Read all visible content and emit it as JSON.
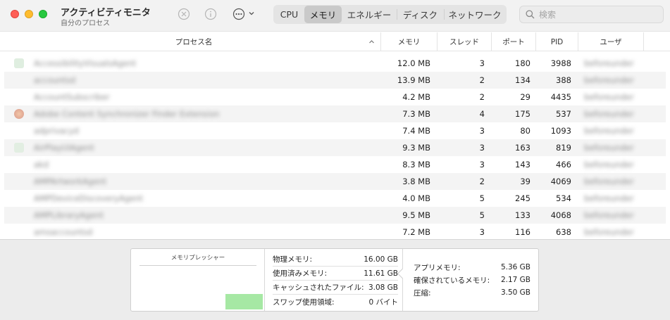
{
  "window": {
    "title": "アクティビティモニタ",
    "subtitle": "自分のプロセス"
  },
  "toolbar": {
    "stop_icon": "x-circle-icon",
    "info_icon": "info-icon",
    "more_icon": "ellipsis-circle-icon",
    "tabs": [
      {
        "label": "CPU",
        "active": false
      },
      {
        "label": "メモリ",
        "active": true
      },
      {
        "label": "エネルギー",
        "active": false
      },
      {
        "label": "ディスク",
        "active": false
      },
      {
        "label": "ネットワーク",
        "active": false
      }
    ],
    "search_placeholder": "検索"
  },
  "table": {
    "headers": {
      "name": "プロセス名",
      "memory": "メモリ",
      "threads": "スレッド",
      "ports": "ポート",
      "pid": "PID",
      "user": "ユーザ"
    },
    "rows": [
      {
        "name": "AccessibilityVisualsAgent",
        "memory": "12.0 MB",
        "threads": "3",
        "ports": "180",
        "pid": "3988",
        "user": "beforeunder",
        "icon_color": "#dfeee0"
      },
      {
        "name": "accountsd",
        "memory": "13.9 MB",
        "threads": "2",
        "ports": "134",
        "pid": "388",
        "user": "beforeunder",
        "icon_color": ""
      },
      {
        "name": "AccountSubscriber",
        "memory": "4.2 MB",
        "threads": "2",
        "ports": "29",
        "pid": "4435",
        "user": "beforeunder",
        "icon_color": ""
      },
      {
        "name": "Adobe Content Synchronizer Finder Extension",
        "memory": "7.3 MB",
        "threads": "4",
        "ports": "175",
        "pid": "537",
        "user": "beforeunder",
        "icon_color": "#e9b9a4"
      },
      {
        "name": "adprivacyd",
        "memory": "7.4 MB",
        "threads": "3",
        "ports": "80",
        "pid": "1093",
        "user": "beforeunder",
        "icon_color": ""
      },
      {
        "name": "AirPlayUIAgent",
        "memory": "9.3 MB",
        "threads": "3",
        "ports": "163",
        "pid": "819",
        "user": "beforeunder",
        "icon_color": "#e2eee2"
      },
      {
        "name": "akd",
        "memory": "8.3 MB",
        "threads": "3",
        "ports": "143",
        "pid": "466",
        "user": "beforeunder",
        "icon_color": ""
      },
      {
        "name": "AMPArtworkAgent",
        "memory": "3.8 MB",
        "threads": "2",
        "ports": "39",
        "pid": "4069",
        "user": "beforeunder",
        "icon_color": ""
      },
      {
        "name": "AMPDeviceDiscoveryAgent",
        "memory": "4.0 MB",
        "threads": "5",
        "ports": "245",
        "pid": "534",
        "user": "beforeunder",
        "icon_color": ""
      },
      {
        "name": "AMPLibraryAgent",
        "memory": "9.5 MB",
        "threads": "5",
        "ports": "133",
        "pid": "4068",
        "user": "beforeunder",
        "icon_color": ""
      },
      {
        "name": "amsaccountsd",
        "memory": "7.2 MB",
        "threads": "3",
        "ports": "116",
        "pid": "638",
        "user": "beforeunder",
        "icon_color": ""
      }
    ]
  },
  "footer": {
    "pressure_title": "メモリプレッシャー",
    "pressure_level": 0.27,
    "pressure_color": "#a6e8a4",
    "physical_label": "物理メモリ:",
    "physical_value": "16.00 GB",
    "used_label": "使用済みメモリ:",
    "used_value": "11.61 GB",
    "cached_label": "キャッシュされたファイル:",
    "cached_value": "3.08 GB",
    "swap_label": "スワップ使用領域:",
    "swap_value": "0 バイト",
    "app_label": "アプリメモリ:",
    "app_value": "5.36 GB",
    "wired_label": "確保されているメモリ:",
    "wired_value": "2.17 GB",
    "compressed_label": "圧縮:",
    "compressed_value": "3.50 GB"
  }
}
